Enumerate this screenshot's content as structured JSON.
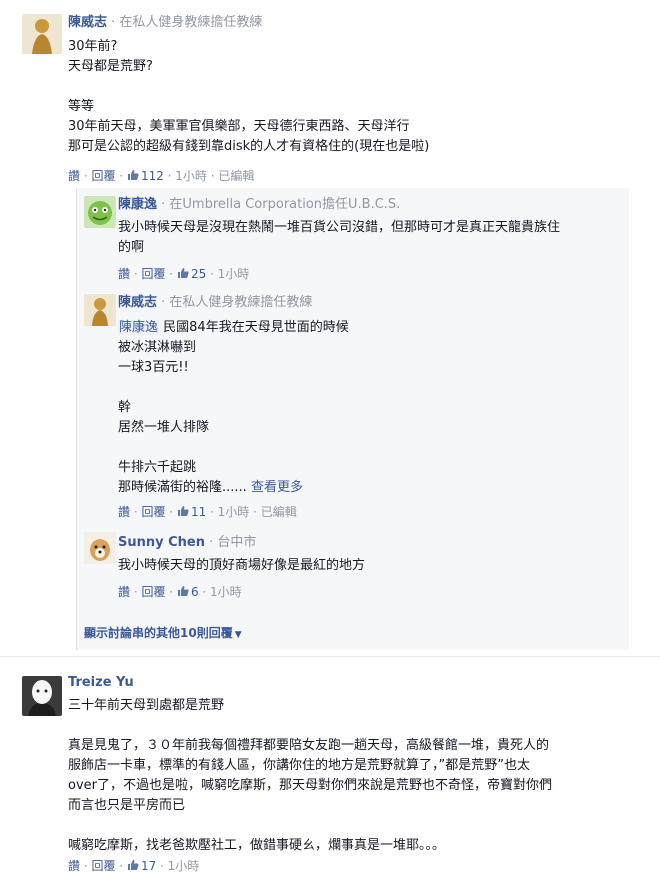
{
  "c1": {
    "author": "陳威志",
    "separator": " · ",
    "meta": "在私人健身教練擔任教練",
    "lines": [
      "30年前?",
      "天母都是荒野?",
      "",
      "等等",
      "30年前天母，美軍軍官俱樂部，天母德行東西路、天母洋行",
      "那可是公認的超級有錢到靠disk的人才有資格住的(現在也是啦)"
    ],
    "actions": {
      "like": "讚",
      "reply": "回覆",
      "likes": "112",
      "time": "1小時",
      "edited": "已編輯"
    }
  },
  "r1": {
    "author": "陳康逸",
    "meta": "在Umbrella Corporation擔任U.B.C.S.",
    "lines": [
      "我小時候天母是沒現在熱鬧一堆百貨公司沒錯，但那時可才是真正天龍貴族住",
      "的啊"
    ],
    "actions": {
      "like": "讚",
      "reply": "回覆",
      "likes": "25",
      "time": "1小時"
    }
  },
  "r2": {
    "author": "陳威志",
    "meta": "在私人健身教練擔任教練",
    "tag": "陳康逸",
    "lines": [
      "民國84年我在天母見世面的時候",
      "被冰淇淋嚇到",
      "一球3百元!!",
      "",
      "幹",
      "居然一堆人排隊",
      "",
      "牛排六千起跳",
      "那時候滿街的裕隆......"
    ],
    "see_more": "查看更多",
    "actions": {
      "like": "讚",
      "reply": "回覆",
      "likes": "11",
      "time": "1小時",
      "edited": "已編輯"
    }
  },
  "r3": {
    "author": "Sunny Chen",
    "meta": "台中市",
    "lines": [
      "我小時候天母的頂好商場好像是最紅的地方"
    ],
    "actions": {
      "like": "讚",
      "reply": "回覆",
      "likes": "6",
      "time": "1小時"
    }
  },
  "show_more": "顯示討論串的其他10則回覆",
  "c2": {
    "author": "Treize Yu",
    "lines": [
      "三十年前天母到處都是荒野",
      "",
      "真是見鬼了，３０年前我每個禮拜都要陪女友跑一趟天母，高級餐館一堆，貴死人的",
      "服飾店一卡車，標準的有錢人區，你講你住的地方是荒野就算了，”都是荒野”也太",
      "over了，不過也是啦，喊窮吃摩斯，那天母對你們來說是荒野也不奇怪，帝寶對你們",
      "而言也只是平房而已",
      "",
      "喊窮吃摩斯，找老爸欺壓社工，做錯事硬ㄠ，爛事真是一堆耶。。。"
    ],
    "actions": {
      "like": "讚",
      "reply": "回覆",
      "likes": "17",
      "time": "1小時"
    }
  },
  "colors": {
    "link": "#3b5998",
    "meta": "#9197a3",
    "text": "#141823"
  }
}
